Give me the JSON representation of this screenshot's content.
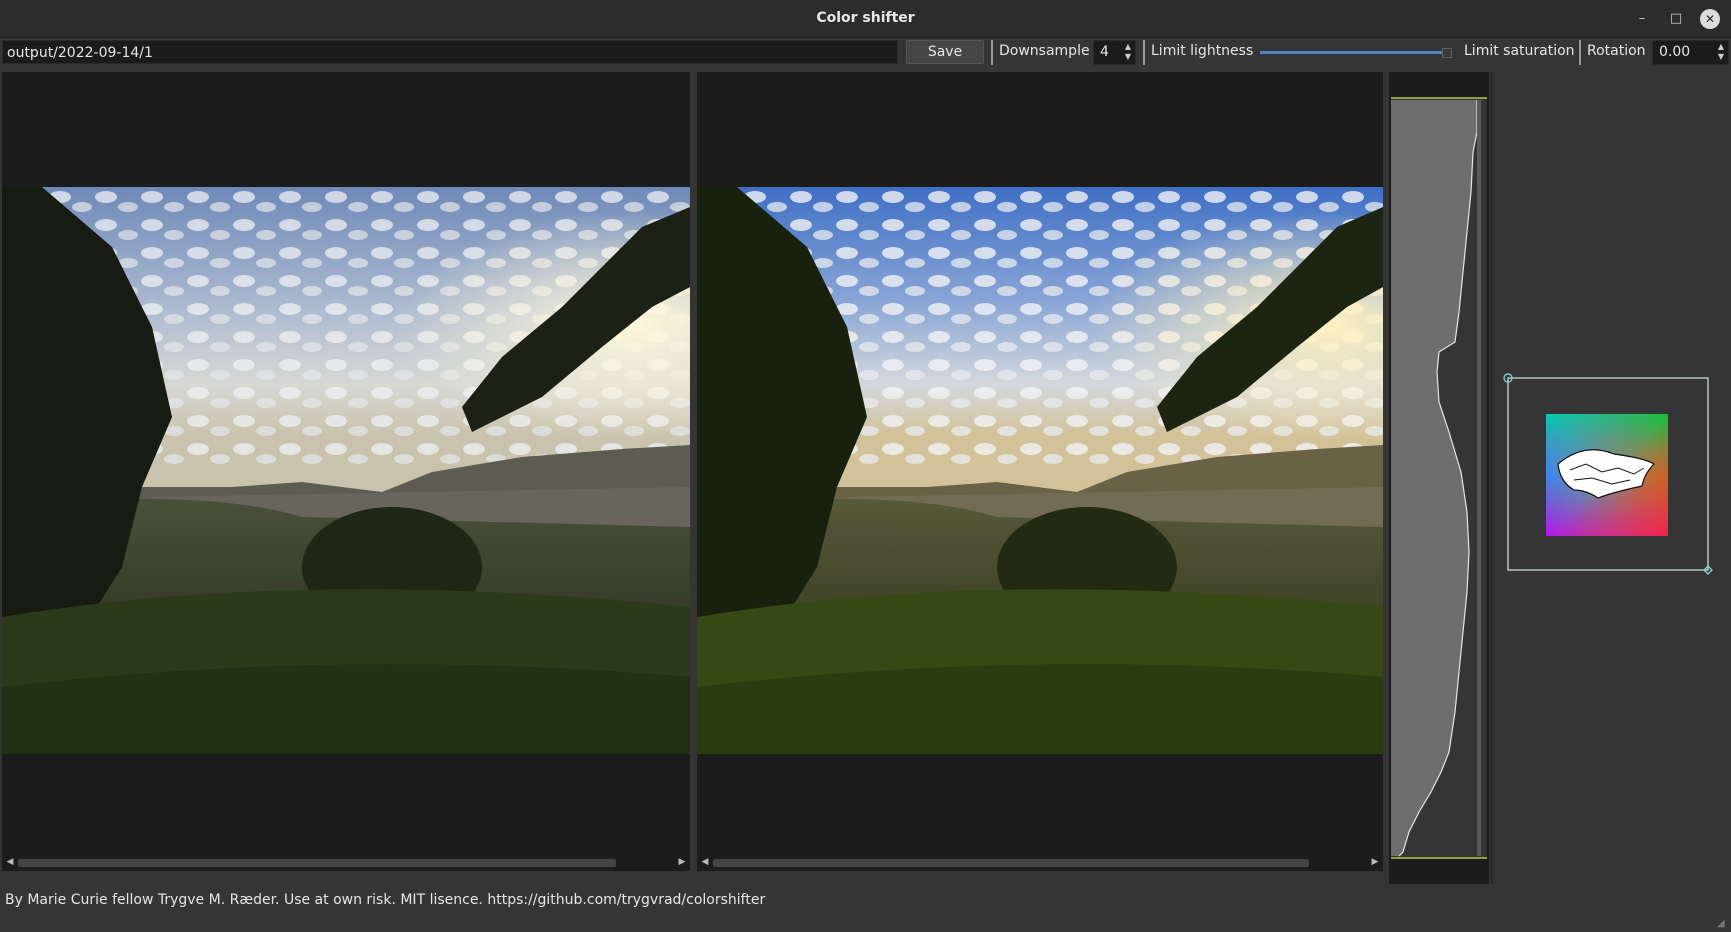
{
  "window": {
    "title": "Color shifter"
  },
  "window_controls": {
    "minimize": "–",
    "maximize": "□",
    "close": "✕"
  },
  "toolbar": {
    "path_value": "output/2022-09-14/1",
    "save_label": "Save",
    "downsample_label": "Downsample",
    "downsample_value": "4",
    "limit_lightness_label": "Limit lightness",
    "limit_saturation_label": "Limit saturation",
    "rotation_label": "Rotation",
    "rotation_value": "0.00",
    "lightness_slider_fraction": 1.0
  },
  "status": {
    "text": "By Marie Curie fellow Trygve M. Ræder. Use at own risk. MIT lisence. https://github.com/trygvrad/colorshifter"
  },
  "icons": {
    "scroll_left": "◀",
    "scroll_right": "▶",
    "spin_up": "▲",
    "spin_down": "▼",
    "resize_grip": "◢"
  },
  "colors": {
    "accent": "#4f86c6",
    "histogram_guide": "#b8c94a",
    "gamut_outline": "#7ad1c9"
  }
}
